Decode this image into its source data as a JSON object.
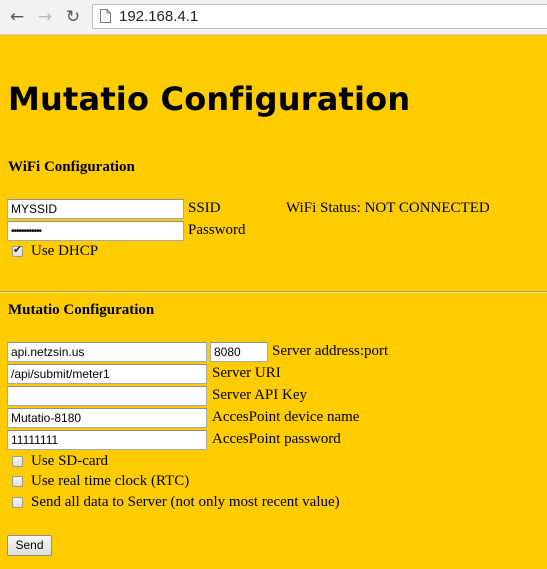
{
  "browser": {
    "url": "192.168.4.1",
    "back_icon": "←",
    "forward_icon": "→",
    "reload_icon": "↻"
  },
  "page": {
    "title": "Mutatio Configuration"
  },
  "wifi": {
    "heading": "WiFi Configuration",
    "ssid_value": "MYSSID",
    "ssid_label": "SSID",
    "status_text": "WiFi Status: NOT CONNECTED",
    "password_value": "••••••••••••",
    "password_label": "Password",
    "dhcp_label": "Use DHCP",
    "dhcp_checked": true
  },
  "mutatio": {
    "heading": "Mutatio Configuration",
    "server_address_value": "api.netzsin.us",
    "server_port_value": "8080",
    "server_address_label": "Server address:port",
    "server_uri_value": "/api/submit/meter1",
    "server_uri_label": "Server URI",
    "api_key_value": "",
    "api_key_label": "Server API Key",
    "ap_name_value": "Mutatio-8180",
    "ap_name_label": "AccesPoint device name",
    "ap_password_value": "11111111",
    "ap_password_label": "AccesPoint password",
    "sdcard_label": "Use SD-card",
    "rtc_label": "Use real time clock (RTC)",
    "send_all_label": "Send all data to Server (not only most recent value)"
  },
  "send_button": "Send"
}
